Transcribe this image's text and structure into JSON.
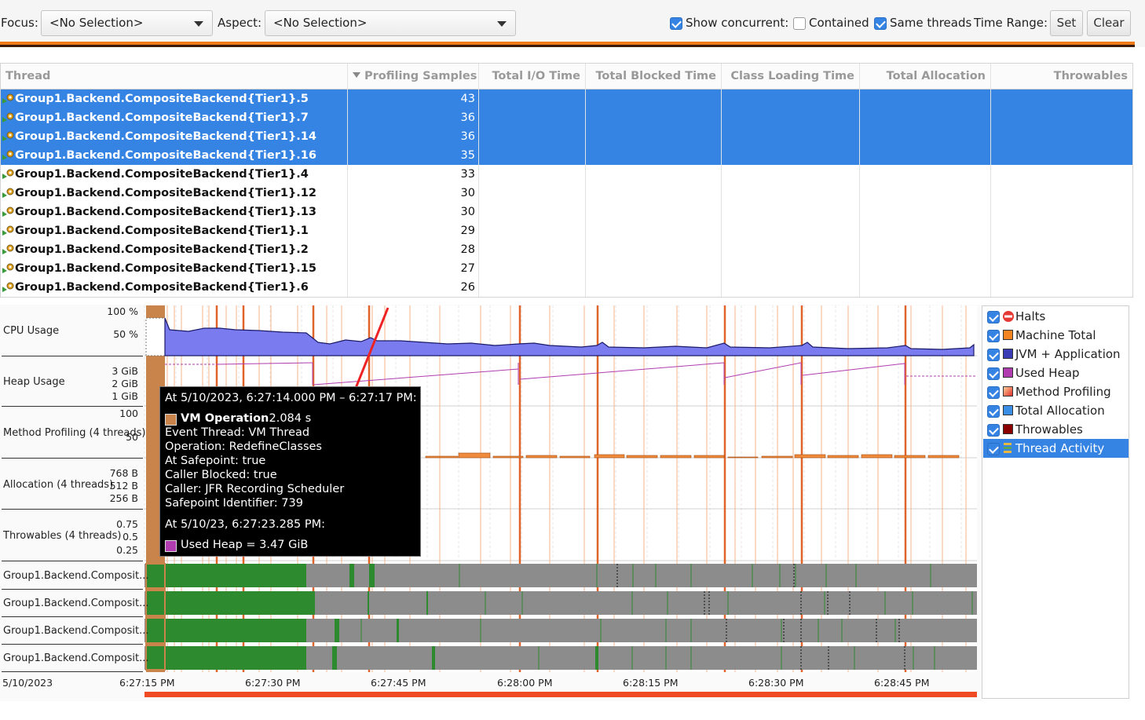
{
  "toolbar": {
    "focus_label": "Focus:",
    "focus_value": "<No Selection>",
    "aspect_label": "Aspect:",
    "aspect_value": "<No Selection>",
    "show_concurrent_label": "Show concurrent:",
    "show_concurrent_checked": true,
    "contained_label": "Contained",
    "contained_checked": false,
    "same_threads_label": "Same threads",
    "same_threads_checked": true,
    "time_range_label": "Time Range:",
    "set_label": "Set",
    "clear_label": "Clear"
  },
  "table": {
    "columns": [
      "Thread",
      "Profiling Samples",
      "Total I/O Time",
      "Total Blocked Time",
      "Class Loading Time",
      "Total Allocation",
      "Throwables"
    ],
    "sorted_column": "Profiling Samples",
    "rows": [
      {
        "name": "Group1.Backend.CompositeBackend{Tier1}.5",
        "samples": "43",
        "selected": true
      },
      {
        "name": "Group1.Backend.CompositeBackend{Tier1}.7",
        "samples": "36",
        "selected": true
      },
      {
        "name": "Group1.Backend.CompositeBackend{Tier1}.14",
        "samples": "36",
        "selected": true
      },
      {
        "name": "Group1.Backend.CompositeBackend{Tier1}.16",
        "samples": "35",
        "selected": true
      },
      {
        "name": "Group1.Backend.CompositeBackend{Tier1}.4",
        "samples": "33",
        "selected": false
      },
      {
        "name": "Group1.Backend.CompositeBackend{Tier1}.12",
        "samples": "30",
        "selected": false
      },
      {
        "name": "Group1.Backend.CompositeBackend{Tier1}.13",
        "samples": "30",
        "selected": false
      },
      {
        "name": "Group1.Backend.CompositeBackend{Tier1}.1",
        "samples": "29",
        "selected": false
      },
      {
        "name": "Group1.Backend.CompositeBackend{Tier1}.2",
        "samples": "28",
        "selected": false
      },
      {
        "name": "Group1.Backend.CompositeBackend{Tier1}.15",
        "samples": "27",
        "selected": false
      },
      {
        "name": "Group1.Backend.CompositeBackend{Tier1}.6",
        "samples": "26",
        "selected": false
      }
    ]
  },
  "chart": {
    "lanes": {
      "cpu": {
        "label": "CPU Usage",
        "ticks": [
          "100 %",
          "50 %"
        ]
      },
      "heap": {
        "label": "Heap Usage",
        "ticks": [
          "3 GiB",
          "2 GiB",
          "1 GiB"
        ]
      },
      "method_profiling": {
        "label": "Method Profiling (4 threads)",
        "ticks": [
          "100",
          "50"
        ]
      },
      "allocation": {
        "label": "Allocation (4 threads)",
        "ticks": [
          "768 B",
          "512 B",
          "256 B"
        ]
      },
      "throwables": {
        "label": "Throwables (4 threads)",
        "ticks": [
          "0.75",
          "0.5",
          "0.25"
        ]
      }
    },
    "thread_lanes": [
      "Group1.Backend.Composit...",
      "Group1.Backend.Composit...",
      "Group1.Backend.Composit...",
      "Group1.Backend.Composit..."
    ],
    "date_label": "5/10/2023",
    "x_ticks": [
      "6:27:15 PM",
      "6:27:30 PM",
      "6:27:45 PM",
      "6:28:00 PM",
      "6:28:15 PM",
      "6:28:30 PM",
      "6:28:45 PM"
    ]
  },
  "legend": [
    {
      "label": "Halts",
      "icon": "no-entry-icon",
      "color": "#e53935",
      "checked": true,
      "selected": false
    },
    {
      "label": "Machine Total",
      "icon": "orange-swatch",
      "color": "#f5861f",
      "checked": true,
      "selected": false
    },
    {
      "label": "JVM + Application",
      "icon": "blue-swatch",
      "color": "#3b3bb5",
      "checked": true,
      "selected": false
    },
    {
      "label": "Used Heap",
      "icon": "magenta-swatch",
      "color": "#b03cb0",
      "checked": true,
      "selected": false
    },
    {
      "label": "Method Profiling",
      "icon": "gradient-swatch",
      "color": "#f08060",
      "checked": true,
      "selected": false
    },
    {
      "label": "Total Allocation",
      "icon": "blue-swatch",
      "color": "#3a8ee6",
      "checked": true,
      "selected": false
    },
    {
      "label": "Throwables",
      "icon": "darkred-swatch",
      "color": "#8b0000",
      "checked": true,
      "selected": false
    },
    {
      "label": "Thread Activity",
      "icon": "thread-activity-icon",
      "color": "#e8b840",
      "checked": true,
      "selected": true
    }
  ],
  "tooltip": {
    "header": "At 5/10/2023, 6:27:14.000 PM – 6:27:17 PM:",
    "event_title": "VM Operation",
    "event_duration": ": 2.084 s",
    "lines": [
      "Event Thread: VM Thread",
      "Operation: RedefineClasses",
      "At Safepoint: true",
      "Caller Blocked: true",
      "Caller: JFR Recording Scheduler",
      "Safepoint Identifier: 739"
    ],
    "heap_header": "At 5/10/23, 6:27:23.285 PM:",
    "heap_value": "Used Heap = 3.47 GiB",
    "event_color": "#c8844a",
    "heap_color": "#b03cb0"
  }
}
